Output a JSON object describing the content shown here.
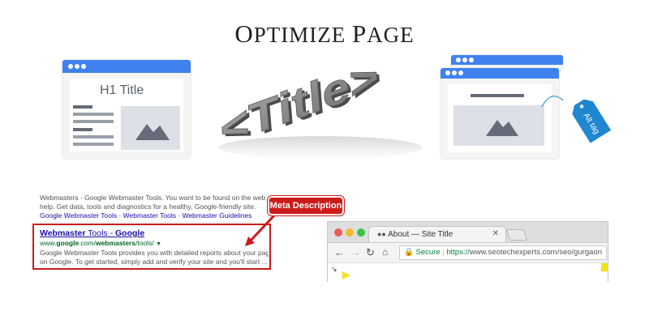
{
  "heading": {
    "first_cap": "O",
    "first_rest": "PTIMIZE",
    "second_cap": "P",
    "second_rest": "AGE"
  },
  "card_left": {
    "title": "H1 Title"
  },
  "title_graphic": {
    "text": "<Title>"
  },
  "tag": {
    "label": "Alt tag"
  },
  "serp": {
    "line1": "Webmasters · Google Webmaster Tools. You want to be found on the web. We want to",
    "line2": "help. Get data, tools and diagnostics for a healthy, Google-friendly site.",
    "links": "Google Webmaster Tools · Webmaster Tools · Webmaster Guidelines",
    "result_title_a": "Webmaster",
    "result_title_b": " Tools - ",
    "result_title_c": "Google",
    "url_a": "www.",
    "url_b": "google",
    "url_c": ".com/",
    "url_d": "webmasters",
    "url_e": "/tools/",
    "desc1": "Google Webmaster Tools provides you with detailed reports about your pages' visibility",
    "desc2": "on Google. To get started, simply add and verify your site and you'll start ..."
  },
  "meta_label": "Meta Description",
  "browser": {
    "tab_title": "About — Site Title",
    "secure_label": "Secure",
    "url_scheme": "https://",
    "url_rest": "www.seotechexperts.com/seo/gurgaon"
  },
  "colors": {
    "accent": "#3f82ee",
    "alert": "#cc1b1b",
    "tag": "#1f86d0"
  }
}
